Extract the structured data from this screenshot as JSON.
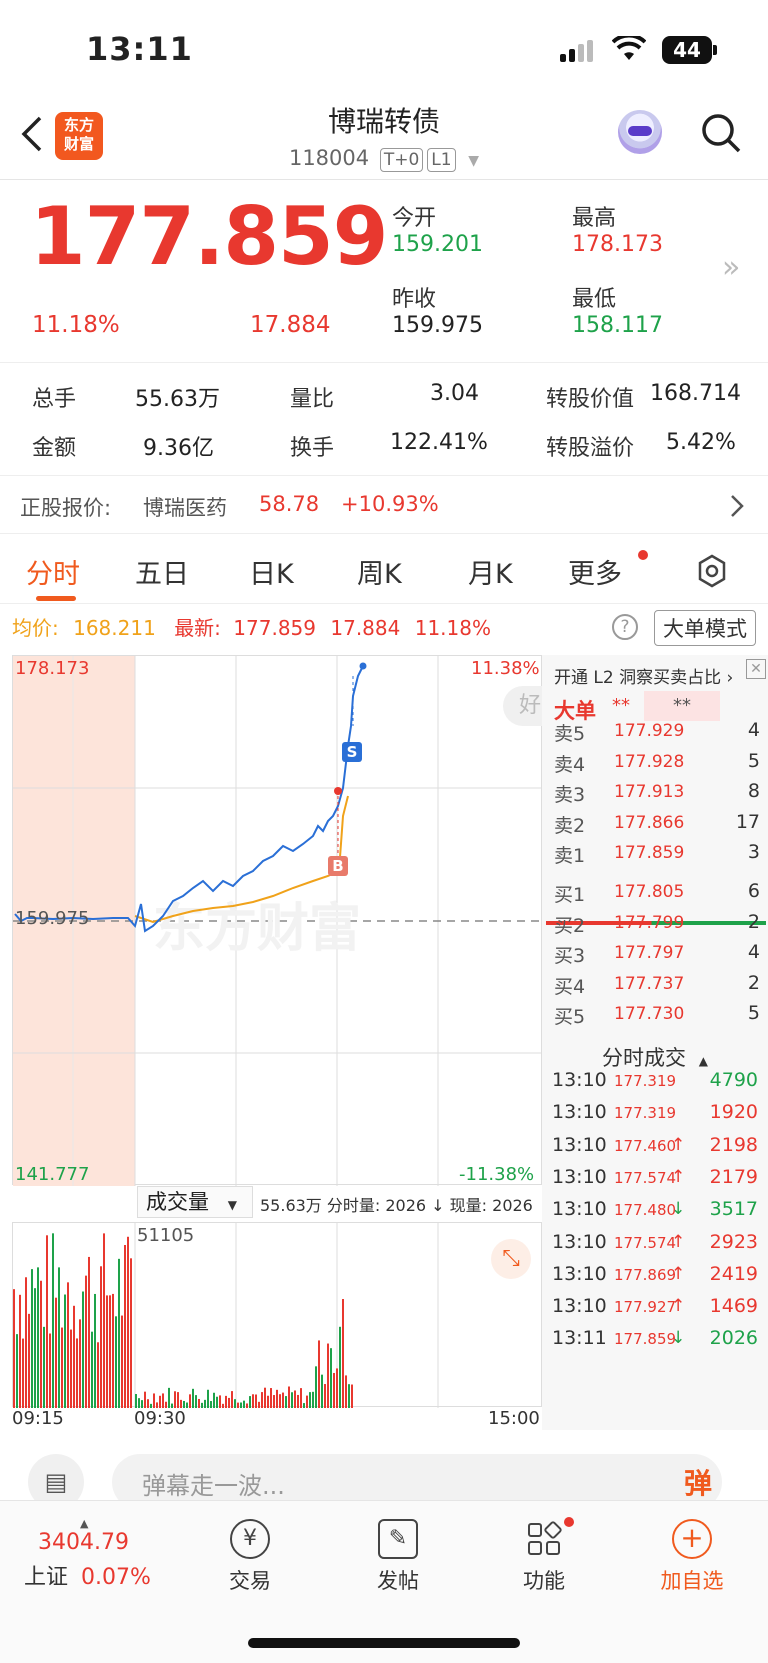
{
  "status_bar": {
    "time": "13:11",
    "battery": "44"
  },
  "header": {
    "back_icon": "chevron-left-icon",
    "logo_text_top": "东方",
    "logo_text_bottom": "财富",
    "title": "博瑞转债",
    "code": "118004",
    "tag1": "T+0",
    "tag2": "L1",
    "search_icon": "search-icon"
  },
  "quote": {
    "price": "177.859",
    "change_pct": "11.18%",
    "change_abs": "17.884",
    "open_label": "今开",
    "open": "159.201",
    "high_label": "最高",
    "high": "178.173",
    "prev_close_label": "昨收",
    "prev_close": "159.975",
    "low_label": "最低",
    "low": "158.117"
  },
  "stats": {
    "volume_label": "总手",
    "volume": "55.63万",
    "ratio_label": "量比",
    "ratio": "3.04",
    "conv_value_label": "转股价值",
    "conv_value": "168.714",
    "amount_label": "金额",
    "amount": "9.36亿",
    "turnover_label": "换手",
    "turnover": "122.41%",
    "premium_label": "转股溢价",
    "premium": "5.42%"
  },
  "related": {
    "label": "正股报价:",
    "name": "博瑞医药",
    "price": "58.78",
    "change": "+10.93%"
  },
  "tabs": [
    "分时",
    "五日",
    "日K",
    "周K",
    "月K",
    "更多"
  ],
  "info_row": {
    "avg_label": "均价:",
    "avg": "168.211",
    "latest_label": "最新:",
    "latest": "177.859",
    "latest_chg": "17.884",
    "latest_pct": "11.18%",
    "mode_button": "大单模式"
  },
  "chart": {
    "y_top": "178.173",
    "y_mid": "159.975",
    "y_bottom": "141.777",
    "pct_top": "11.38%",
    "pct_bottom": "-11.38%",
    "watermark": "东方财富",
    "marker_s": "S",
    "marker_b": "B",
    "bubble": "好"
  },
  "volume": {
    "selector": "成交量",
    "summary": "55.63万 分时量: 2026 ↓ 现量: 2026",
    "max": "51105",
    "x_start": "09:15",
    "x_open": "09:30",
    "x_end": "15:00"
  },
  "orderbook": {
    "l2_promo": "开通 L2 洞察买卖占比",
    "big_label": "大单",
    "big_val1": "**",
    "big_val2": "**",
    "asks": [
      {
        "label": "卖5",
        "price": "177.929",
        "qty": "4"
      },
      {
        "label": "卖4",
        "price": "177.928",
        "qty": "5"
      },
      {
        "label": "卖3",
        "price": "177.913",
        "qty": "8"
      },
      {
        "label": "卖2",
        "price": "177.866",
        "qty": "17"
      },
      {
        "label": "卖1",
        "price": "177.859",
        "qty": "3"
      }
    ],
    "bids": [
      {
        "label": "买1",
        "price": "177.805",
        "qty": "6"
      },
      {
        "label": "买2",
        "price": "177.799",
        "qty": "2"
      },
      {
        "label": "买3",
        "price": "177.797",
        "qty": "4"
      },
      {
        "label": "买4",
        "price": "177.737",
        "qty": "2"
      },
      {
        "label": "买5",
        "price": "177.730",
        "qty": "5"
      }
    ],
    "ticks_title": "分时成交",
    "ticks": [
      {
        "time": "13:10",
        "price": "177.319",
        "dir": "",
        "qty": "4790",
        "color": "green"
      },
      {
        "time": "13:10",
        "price": "177.319",
        "dir": "",
        "qty": "1920",
        "color": "red"
      },
      {
        "time": "13:10",
        "price": "177.460",
        "dir": "↑",
        "qty": "2198",
        "color": "red"
      },
      {
        "time": "13:10",
        "price": "177.574",
        "dir": "↑",
        "qty": "2179",
        "color": "red"
      },
      {
        "time": "13:10",
        "price": "177.480",
        "dir": "↓",
        "qty": "3517",
        "color": "green"
      },
      {
        "time": "13:10",
        "price": "177.574",
        "dir": "↑",
        "qty": "2923",
        "color": "red"
      },
      {
        "time": "13:10",
        "price": "177.869",
        "dir": "↑",
        "qty": "2419",
        "color": "red"
      },
      {
        "time": "13:10",
        "price": "177.927",
        "dir": "↑",
        "qty": "1469",
        "color": "red"
      },
      {
        "time": "13:11",
        "price": "177.859",
        "dir": "↓",
        "qty": "2026",
        "color": "green"
      }
    ]
  },
  "danmaku": {
    "placeholder": "弹幕走一波...",
    "button": "弹"
  },
  "navbar": {
    "index_value": "3404.79",
    "index_name": "上证",
    "index_pct": "0.07%",
    "items": [
      "交易",
      "发帖",
      "功能",
      "加自选"
    ]
  },
  "colors": {
    "up": "#e8382f",
    "down": "#1ea24a",
    "accent": "#f05a1e",
    "avg_line": "#f0a21a",
    "price_line": "#2a6fd6"
  }
}
